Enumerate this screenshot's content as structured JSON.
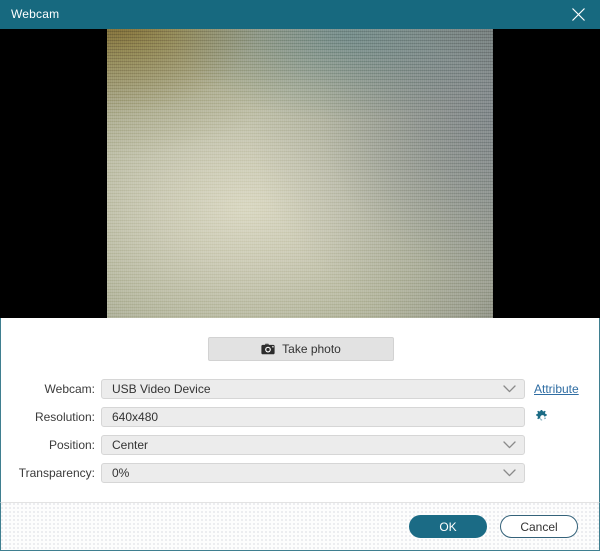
{
  "window": {
    "title": "Webcam",
    "close_icon": "close-icon",
    "titlebar_color": "#17697f",
    "border_color": "#3f7f90"
  },
  "preview": {
    "letterbox_color": "#000000",
    "description": "live webcam preview"
  },
  "actions": {
    "take_photo_label": "Take photo",
    "take_photo_icon": "camera-icon"
  },
  "form": {
    "rows": [
      {
        "label": "Webcam:",
        "value": "USB Video Device",
        "control": "dropdown",
        "trailing": {
          "type": "link",
          "label": "Attribute",
          "color": "#2f6da3"
        }
      },
      {
        "label": "Resolution:",
        "value": "640x480",
        "control": "text",
        "trailing": {
          "type": "icon",
          "name": "gear-icon",
          "color": "#1b6b85"
        }
      },
      {
        "label": "Position:",
        "value": "Center",
        "control": "dropdown",
        "trailing": null
      },
      {
        "label": "Transparency:",
        "value": "0%",
        "control": "dropdown",
        "trailing": null
      }
    ]
  },
  "footer": {
    "ok_label": "OK",
    "cancel_label": "Cancel",
    "ok_color": "#1b6b85"
  }
}
